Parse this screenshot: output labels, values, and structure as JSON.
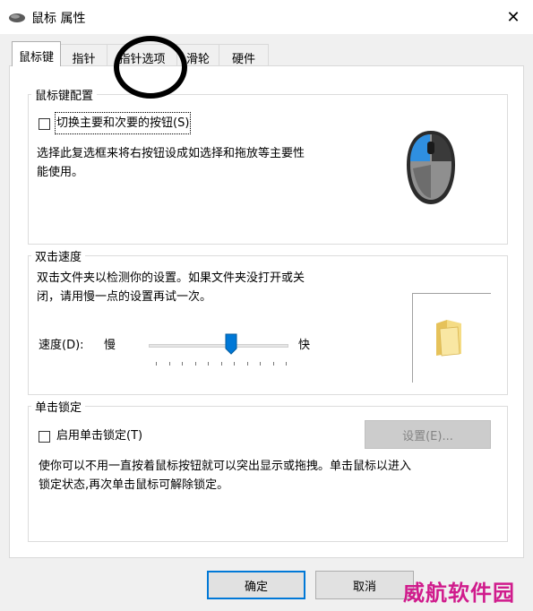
{
  "window": {
    "title": "鼠标 属性",
    "close_icon": "✕"
  },
  "tabs": [
    {
      "label": "鼠标键",
      "active": true
    },
    {
      "label": "指针"
    },
    {
      "label": "指针选项"
    },
    {
      "label": "滑轮"
    },
    {
      "label": "硬件"
    }
  ],
  "button_config": {
    "group_title": "鼠标键配置",
    "swap_label": "切换主要和次要的按钮(S)",
    "description_line1": "选择此复选框来将右按钮设成如选择和拖放等主要性",
    "description_line2": "能使用。"
  },
  "double_click": {
    "group_title": "双击速度",
    "description_line1": "双击文件夹以检测你的设置。如果文件夹没打开或关",
    "description_line2": "闭，请用慢一点的设置再试一次。",
    "speed_label": "速度(D):",
    "slow_label": "慢",
    "fast_label": "快",
    "speed_level": 0.59
  },
  "click_lock": {
    "group_title": "单击锁定",
    "enable_label": "启用单击锁定(T)",
    "settings_button": "设置(E)...",
    "description_line1": "使你可以不用一直按着鼠标按钮就可以突出显示或拖拽。单击鼠标以进入",
    "description_line2": "锁定状态,再次单击鼠标可解除锁定。"
  },
  "footer": {
    "ok_label": "确定",
    "cancel_label": "取消"
  },
  "watermark": "威航软件园",
  "colors": {
    "accent": "#0078d7",
    "watermark": "#d01b8c"
  }
}
